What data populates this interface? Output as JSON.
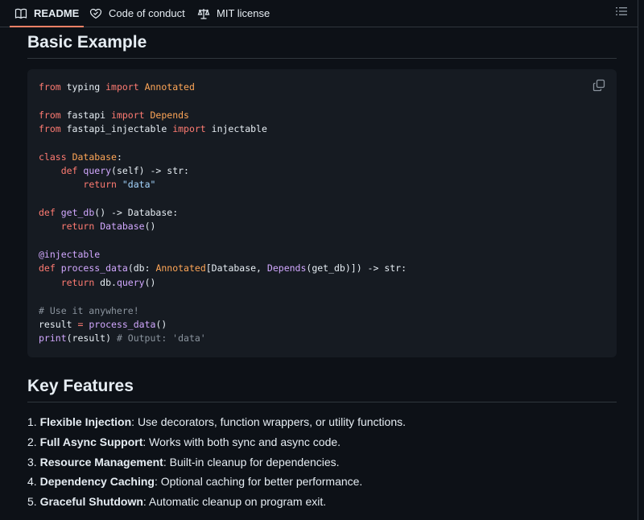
{
  "tabs": [
    {
      "label": "README",
      "icon": "book-icon"
    },
    {
      "label": "Code of conduct",
      "icon": "heart-icon"
    },
    {
      "label": "MIT license",
      "icon": "scale-icon"
    }
  ],
  "sections": {
    "basic_example_title": "Basic Example",
    "key_features_title": "Key Features"
  },
  "code_lines": [
    [
      {
        "t": "from",
        "c": "kw"
      },
      {
        "t": " typing "
      },
      {
        "t": "import",
        "c": "kw"
      },
      {
        "t": " "
      },
      {
        "t": "Annotated",
        "c": "cls"
      }
    ],
    [],
    [
      {
        "t": "from",
        "c": "kw"
      },
      {
        "t": " fastapi "
      },
      {
        "t": "import",
        "c": "kw"
      },
      {
        "t": " "
      },
      {
        "t": "Depends",
        "c": "cls"
      }
    ],
    [
      {
        "t": "from",
        "c": "kw"
      },
      {
        "t": " fastapi_injectable "
      },
      {
        "t": "import",
        "c": "kw"
      },
      {
        "t": " injectable"
      }
    ],
    [],
    [
      {
        "t": "class",
        "c": "kw"
      },
      {
        "t": " "
      },
      {
        "t": "Database",
        "c": "cls"
      },
      {
        "t": ":"
      }
    ],
    [
      {
        "t": "    "
      },
      {
        "t": "def",
        "c": "kw"
      },
      {
        "t": " "
      },
      {
        "t": "query",
        "c": "fn"
      },
      {
        "t": "(self) -> str:"
      }
    ],
    [
      {
        "t": "        "
      },
      {
        "t": "return",
        "c": "kw"
      },
      {
        "t": " "
      },
      {
        "t": "\"data\"",
        "c": "str"
      }
    ],
    [],
    [
      {
        "t": "def",
        "c": "kw"
      },
      {
        "t": " "
      },
      {
        "t": "get_db",
        "c": "fn"
      },
      {
        "t": "() -> Database:"
      }
    ],
    [
      {
        "t": "    "
      },
      {
        "t": "return",
        "c": "kw"
      },
      {
        "t": " "
      },
      {
        "t": "Database",
        "c": "fn"
      },
      {
        "t": "()"
      }
    ],
    [],
    [
      {
        "t": "@injectable",
        "c": "dec"
      }
    ],
    [
      {
        "t": "def",
        "c": "kw"
      },
      {
        "t": " "
      },
      {
        "t": "process_data",
        "c": "fn"
      },
      {
        "t": "(db: "
      },
      {
        "t": "Annotated",
        "c": "cls"
      },
      {
        "t": "[Database, "
      },
      {
        "t": "Depends",
        "c": "fn"
      },
      {
        "t": "(get_db)]) -> str:"
      }
    ],
    [
      {
        "t": "    "
      },
      {
        "t": "return",
        "c": "kw"
      },
      {
        "t": " db."
      },
      {
        "t": "query",
        "c": "fn"
      },
      {
        "t": "()"
      }
    ],
    [],
    [
      {
        "t": "# Use it anywhere!",
        "c": "cm"
      }
    ],
    [
      {
        "t": "result "
      },
      {
        "t": "=",
        "c": "kw"
      },
      {
        "t": " "
      },
      {
        "t": "process_data",
        "c": "fn"
      },
      {
        "t": "()"
      }
    ],
    [
      {
        "t": "print",
        "c": "fn"
      },
      {
        "t": "(result) "
      },
      {
        "t": "# Output: 'data'",
        "c": "cm"
      }
    ]
  ],
  "features": [
    {
      "num": "1.",
      "title": "Flexible Injection",
      "desc": ": Use decorators, function wrappers, or utility functions."
    },
    {
      "num": "2.",
      "title": "Full Async Support",
      "desc": ": Works with both sync and async code."
    },
    {
      "num": "3.",
      "title": "Resource Management",
      "desc": ": Built-in cleanup for dependencies."
    },
    {
      "num": "4.",
      "title": "Dependency Caching",
      "desc": ": Optional caching for better performance."
    },
    {
      "num": "5.",
      "title": "Graceful Shutdown",
      "desc": ": Automatic cleanup on program exit."
    }
  ],
  "colors": {
    "background": "#0d1117",
    "code_background": "#161b22",
    "border": "#30363d",
    "active_tab_underline": "#f78166",
    "keyword": "#ff7b72",
    "function": "#d2a8ff",
    "class": "#ffa657",
    "string": "#a5d6ff",
    "comment": "#8b949e"
  }
}
